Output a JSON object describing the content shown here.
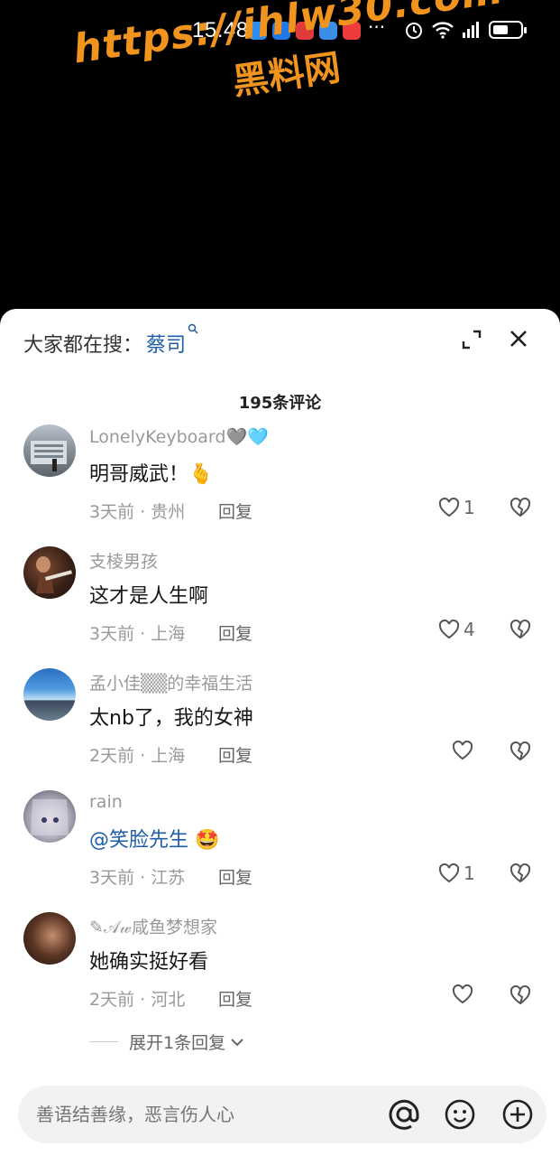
{
  "status_bar": {
    "time": "15:48",
    "more": "···"
  },
  "watermark": {
    "url": "https://ihlw30.com",
    "text": "黑料网"
  },
  "search": {
    "prefix": "大家都在搜：",
    "keyword": "蔡司"
  },
  "comments_count": "195条评论",
  "comments": [
    {
      "name": "LonelyKeyboard🩶🩵",
      "text": "明哥威武！🫰",
      "time": "3天前",
      "location": "贵州",
      "reply": "回复",
      "likes": "1"
    },
    {
      "name": "支棱男孩",
      "text": "这才是人生啊",
      "time": "3天前",
      "location": "上海",
      "reply": "回复",
      "likes": "4"
    },
    {
      "name": "孟小佳▒▒的幸福生活",
      "text": "太nb了，我的女神",
      "time": "2天前",
      "location": "上海",
      "reply": "回复",
      "likes": ""
    },
    {
      "name": "rain",
      "mention": "@笑脸先生",
      "text": "🤩",
      "time": "3天前",
      "location": "江苏",
      "reply": "回复",
      "likes": "1"
    },
    {
      "name": "✎𝒜𝓌咸鱼梦想家",
      "text": "她确实挺好看",
      "time": "2天前",
      "location": "河北",
      "reply": "回复",
      "likes": ""
    }
  ],
  "expand_replies": "展开1条回复",
  "input": {
    "placeholder": "善语结善缘，恶言伤人心"
  },
  "colors": {
    "link": "#1e5fa8",
    "watermark": "#f0941e",
    "muted": "#999999"
  }
}
